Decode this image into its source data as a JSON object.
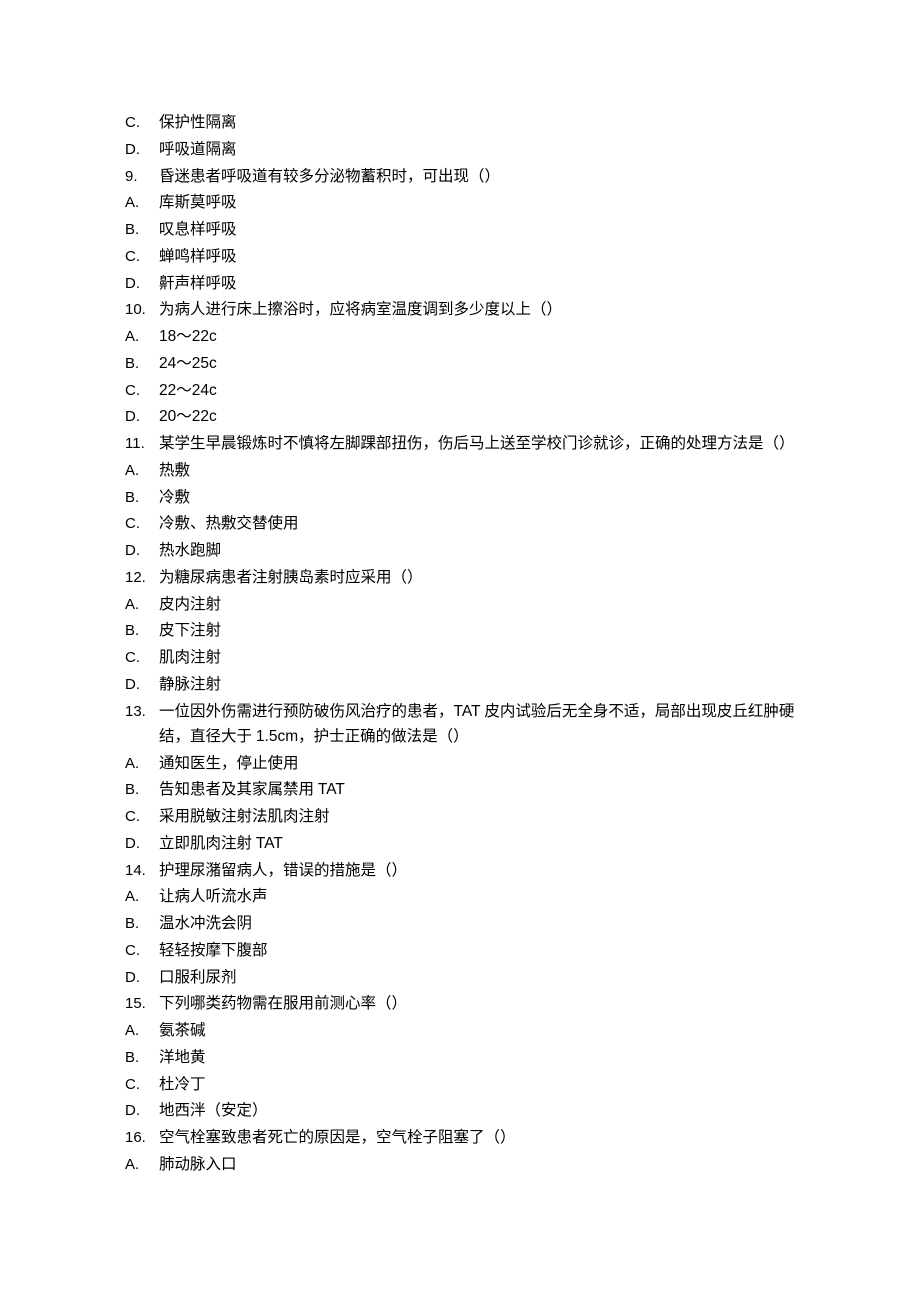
{
  "items": [
    {
      "marker": "C.",
      "text": "保护性隔离"
    },
    {
      "marker": "D.",
      "text": "呼吸道隔离"
    },
    {
      "marker": "9.",
      "text": "昏迷患者呼吸道有较多分泌物蓄积时，可出现（）"
    },
    {
      "marker": "A.",
      "text": "库斯莫呼吸"
    },
    {
      "marker": "B.",
      "text": "叹息样呼吸"
    },
    {
      "marker": "C.",
      "text": "蝉鸣样呼吸"
    },
    {
      "marker": "D.",
      "text": "鼾声样呼吸"
    },
    {
      "marker": "10.",
      "text": "为病人进行床上擦浴时，应将病室温度调到多少度以上（）"
    },
    {
      "marker": "A.",
      "text": "18～22c"
    },
    {
      "marker": "B.",
      "text": "24～25c"
    },
    {
      "marker": "C.",
      "text": "22～24c"
    },
    {
      "marker": "D.",
      "text": "20～22c"
    },
    {
      "marker": "11.",
      "text": "某学生早晨锻炼时不慎将左脚踝部扭伤，伤后马上送至学校门诊就诊，正确的处理方法是（）",
      "wrap": true
    },
    {
      "marker": "A.",
      "text": "热敷"
    },
    {
      "marker": "B.",
      "text": "冷敷"
    },
    {
      "marker": "C.",
      "text": "冷敷、热敷交替使用"
    },
    {
      "marker": "D.",
      "text": "热水跑脚"
    },
    {
      "marker": "12.",
      "text": "为糖尿病患者注射胰岛素时应采用（）"
    },
    {
      "marker": "A.",
      "text": "皮内注射"
    },
    {
      "marker": "B.",
      "text": "皮下注射"
    },
    {
      "marker": "C.",
      "text": "肌肉注射"
    },
    {
      "marker": "D.",
      "text": "静脉注射"
    },
    {
      "marker": "13.",
      "text": "一位因外伤需进行预防破伤风治疗的患者，TAT 皮内试验后无全身不适，局部出现皮丘红肿硬结，直径大于 1.5cm，护士正确的做法是（）",
      "wrap": true
    },
    {
      "marker": "A.",
      "text": "通知医生，停止使用"
    },
    {
      "marker": "B.",
      "text": "告知患者及其家属禁用 TAT"
    },
    {
      "marker": "C.",
      "text": "采用脱敏注射法肌肉注射"
    },
    {
      "marker": "D.",
      "text": "立即肌肉注射 TAT"
    },
    {
      "marker": "14.",
      "text": "护理尿潴留病人，错误的措施是（）"
    },
    {
      "marker": "A.",
      "text": "让病人听流水声"
    },
    {
      "marker": "B.",
      "text": "温水冲洗会阴"
    },
    {
      "marker": "C.",
      "text": "轻轻按摩下腹部"
    },
    {
      "marker": "D.",
      "text": "口服利尿剂"
    },
    {
      "marker": "15.",
      "text": "下列哪类药物需在服用前测心率（）"
    },
    {
      "marker": "A.",
      "text": "氨茶碱"
    },
    {
      "marker": "B.",
      "text": "洋地黄"
    },
    {
      "marker": "C.",
      "text": "杜冷丁"
    },
    {
      "marker": "D.",
      "text": "地西泮（安定）"
    },
    {
      "marker": "16.",
      "text": "空气栓塞致患者死亡的原因是，空气栓子阻塞了（）"
    },
    {
      "marker": "A.",
      "text": "肺动脉入口"
    }
  ]
}
